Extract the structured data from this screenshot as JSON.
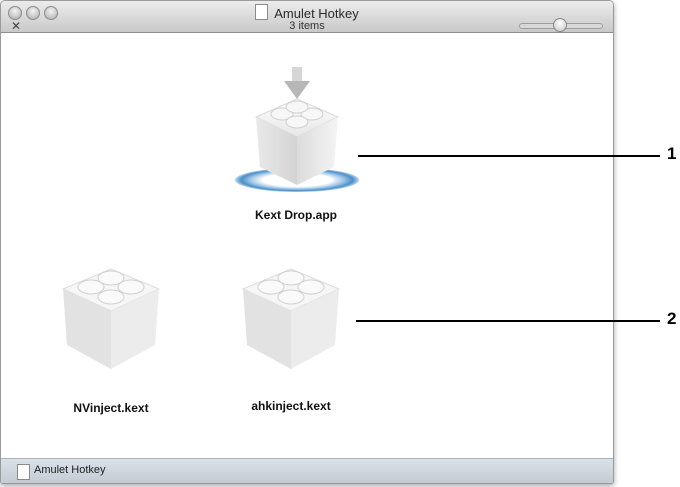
{
  "window": {
    "title": "Amulet Hotkey",
    "item_count": "3 items",
    "status_bar_label": "Amulet Hotkey"
  },
  "icons": {
    "pin": "pin-icon",
    "app": "kext-drop-app-icon",
    "kext": "kernel-extension-icon"
  },
  "items": [
    {
      "label": "Kext Drop.app",
      "kind": "app"
    },
    {
      "label": "NVinject.kext",
      "kind": "kext"
    },
    {
      "label": "ahkinject.kext",
      "kind": "kext"
    }
  ],
  "callouts": [
    {
      "number": "1"
    },
    {
      "number": "2"
    }
  ]
}
